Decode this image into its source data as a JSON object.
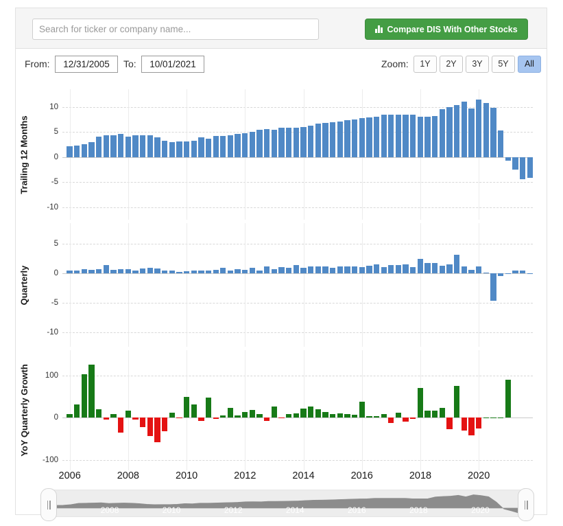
{
  "header": {
    "search": {
      "placeholder": "Search for ticker or company name...",
      "value": ""
    },
    "compare_button": {
      "label": "Compare DIS With Other Stocks",
      "icon": "bar-chart-icon",
      "color": "#449d44"
    }
  },
  "controls": {
    "from_label": "From:",
    "from_value": "12/31/2005",
    "to_label": "To:",
    "to_value": "10/01/2021",
    "zoom_label": "Zoom:",
    "zoom_options": [
      "1Y",
      "2Y",
      "3Y",
      "5Y",
      "All"
    ],
    "zoom_selected": "All"
  },
  "colors": {
    "bar_blue": "#5089c6",
    "growth_positive_green": "#177a17",
    "growth_negative_red": "#e41212",
    "accent_active": "#a6c5f0",
    "panel_background": "#f5f5f5"
  },
  "navigator": {
    "x_labels": [
      "2006",
      "2008",
      "2010",
      "2012",
      "2014",
      "2016",
      "2018",
      "2020"
    ],
    "handle_left": "||",
    "handle_right": "||"
  },
  "chart_data": [
    {
      "type": "bar",
      "title": "",
      "ylabel": "Trailing 12 Months",
      "xlabel": "",
      "ylim": [
        -12.5,
        13.5
      ],
      "yticks": [
        10,
        5,
        0,
        -5,
        -10
      ],
      "ytick_labels": [
        "10",
        "5",
        "0",
        "-5",
        "-10"
      ],
      "grid": true,
      "bar_color": "#5089c6",
      "x_start": 2006.0,
      "x_step": 0.25,
      "x": [
        2006.0,
        2006.25,
        2006.5,
        2006.75,
        2007.0,
        2007.25,
        2007.5,
        2007.75,
        2008.0,
        2008.25,
        2008.5,
        2008.75,
        2009.0,
        2009.25,
        2009.5,
        2009.75,
        2010.0,
        2010.25,
        2010.5,
        2010.75,
        2011.0,
        2011.25,
        2011.5,
        2011.75,
        2012.0,
        2012.25,
        2012.5,
        2012.75,
        2013.0,
        2013.25,
        2013.5,
        2013.75,
        2014.0,
        2014.25,
        2014.5,
        2014.75,
        2015.0,
        2015.25,
        2015.5,
        2015.75,
        2016.0,
        2016.25,
        2016.5,
        2016.75,
        2017.0,
        2017.25,
        2017.5,
        2017.75,
        2018.0,
        2018.25,
        2018.5,
        2018.75,
        2019.0,
        2019.25,
        2019.5,
        2019.75,
        2020.0,
        2020.25,
        2020.5,
        2020.75,
        2021.0,
        2021.25,
        2021.5
      ],
      "values": [
        2.2,
        2.3,
        2.5,
        3.0,
        4.1,
        4.3,
        4.4,
        4.6,
        4.0,
        4.3,
        4.4,
        4.3,
        3.9,
        3.3,
        3.0,
        3.1,
        3.1,
        3.3,
        3.9,
        3.7,
        4.2,
        4.2,
        4.4,
        4.6,
        4.8,
        5.0,
        5.4,
        5.5,
        5.4,
        5.8,
        5.8,
        5.9,
        6.0,
        6.2,
        6.6,
        6.8,
        6.9,
        7.1,
        7.3,
        7.5,
        7.7,
        7.9,
        8.0,
        8.4,
        8.4,
        8.4,
        8.4,
        8.4,
        8.0,
        8.0,
        8.1,
        9.6,
        10.0,
        10.3,
        11.0,
        9.7,
        11.5,
        10.8,
        9.8,
        5.3,
        -0.8,
        -2.5,
        -4.4,
        -4.2
      ]
    },
    {
      "type": "bar",
      "title": "",
      "ylabel": "Quarterly",
      "xlabel": "",
      "ylim": [
        -12.5,
        8.5
      ],
      "yticks": [
        5,
        0,
        -5,
        -10
      ],
      "ytick_labels": [
        "5",
        "0",
        "-5",
        "-10"
      ],
      "grid": true,
      "bar_color": "#5089c6",
      "x_start": 2006.0,
      "x_step": 0.25,
      "values": [
        0.5,
        0.4,
        0.7,
        0.6,
        0.7,
        1.4,
        0.6,
        0.7,
        0.7,
        0.5,
        0.8,
        0.9,
        0.8,
        0.4,
        0.4,
        0.2,
        0.3,
        0.5,
        0.4,
        0.5,
        0.6,
        0.9,
        0.5,
        0.7,
        0.6,
        0.9,
        0.5,
        1.1,
        0.7,
        1.0,
        0.9,
        1.4,
        0.9,
        1.1,
        1.1,
        1.2,
        0.9,
        1.1,
        1.1,
        1.2,
        1.0,
        1.3,
        1.5,
        1.0,
        1.4,
        1.4,
        1.5,
        1.0,
        2.4,
        1.7,
        1.7,
        1.3,
        1.5,
        3.1,
        1.2,
        0.6,
        1.1,
        0.1,
        -4.7,
        -0.5,
        0.0,
        0.4,
        0.4,
        -0.1
      ]
    },
    {
      "type": "bar",
      "title": "",
      "ylabel": "YoY Quarterly Growth",
      "xlabel": "",
      "ylim": [
        -125,
        160
      ],
      "yticks": [
        100,
        0,
        -100
      ],
      "ytick_labels": [
        "100",
        "0",
        "-100"
      ],
      "grid": true,
      "positive_color": "#177a17",
      "negative_color": "#e41212",
      "x_start": 2006.0,
      "x_step": 0.25,
      "values": [
        8,
        32,
        103,
        125,
        20,
        -5,
        8,
        -35,
        16,
        -4,
        -22,
        -43,
        -58,
        -33,
        11,
        -1,
        50,
        32,
        -8,
        48,
        -3,
        6,
        23,
        6,
        14,
        18,
        9,
        -8,
        26,
        -1,
        8,
        10,
        22,
        27,
        20,
        14,
        8,
        10,
        9,
        7,
        38,
        3,
        4,
        9,
        -13,
        12,
        -9,
        -3,
        70,
        16,
        17,
        23,
        -27,
        75,
        -31,
        -42,
        -25,
        0,
        0,
        0,
        90
      ]
    }
  ]
}
